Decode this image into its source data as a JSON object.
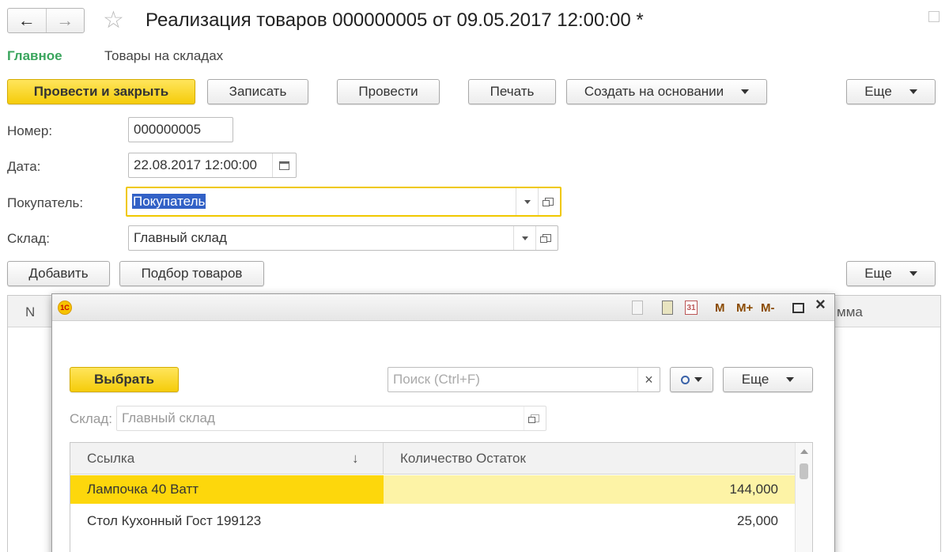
{
  "window": {
    "title": "Реализация товаров 000000005 от 09.05.2017 12:00:00 *"
  },
  "nav": {
    "back": "←",
    "forward": "→",
    "star": "☆"
  },
  "tabs": [
    {
      "label": "Главное",
      "active": true
    },
    {
      "label": "Товары на складах",
      "active": false
    }
  ],
  "toolbar": {
    "post_and_close": "Провести и закрыть",
    "save": "Записать",
    "post": "Провести",
    "print": "Печать",
    "create_based": "Создать на основании",
    "more": "Еще"
  },
  "form": {
    "number_label": "Номер:",
    "number_value": "000000005",
    "date_label": "Дата:",
    "date_value": "22.08.2017 12:00:00",
    "buyer_label": "Покупатель:",
    "buyer_value": "Покупатель",
    "warehouse_label": "Склад:",
    "warehouse_value": "Главный склад"
  },
  "table_toolbar": {
    "add": "Добавить",
    "pick_goods": "Подбор товаров",
    "more": "Еще"
  },
  "main_table": {
    "col_n": "N",
    "col_sum_partial": "мма"
  },
  "popup": {
    "logo": "1С",
    "title_icons": [
      "M",
      "M+",
      "M-"
    ],
    "select": "Выбрать",
    "search_placeholder": "Поиск (Ctrl+F)",
    "clear": "×",
    "more": "Еще",
    "warehouse_label": "Склад:",
    "warehouse_value": "Главный склад",
    "columns": {
      "link": "Ссылка",
      "sort_arrow": "↓",
      "qty": "Количество Остаток"
    },
    "rows": [
      {
        "name": "Лампочка 40 Ватт",
        "qty": "144,000",
        "selected": true
      },
      {
        "name": "Стол Кухонный Гост 199123",
        "qty": "25,000",
        "selected": false
      }
    ]
  },
  "colors": {
    "accent_yellow": "#f5cc0a",
    "tab_green": "#3aa55d",
    "focus_border": "#f0c800",
    "selected_row": "#fdd70c",
    "selected_row_light": "#fdf3a6",
    "selection_text_bg": "#3261c6"
  }
}
